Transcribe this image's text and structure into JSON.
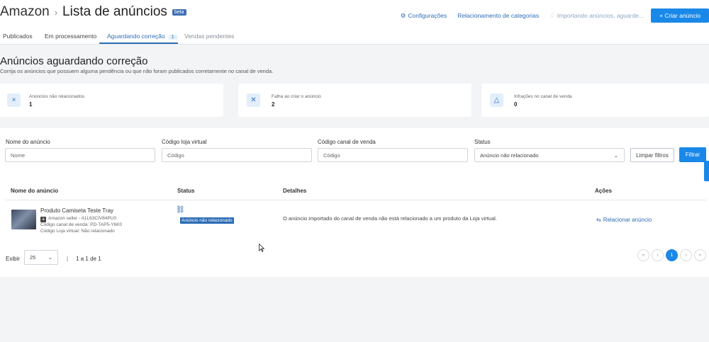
{
  "header": {
    "marketplace": "Amazon",
    "separator": "›",
    "title": "Lista de anúncios",
    "badge": "beta",
    "actions": [
      {
        "icon": "gear-icon",
        "label": "Configurações"
      },
      {
        "icon": "",
        "label": "Relacionamento de categorias"
      },
      {
        "icon": "lightbulb-icon",
        "label": "Importando anúncios, aguarde..."
      }
    ],
    "create_button": "+ Criar anúncio"
  },
  "tabs": [
    {
      "label": "Publicados",
      "count": null,
      "active": false
    },
    {
      "label": "Em processamento",
      "count": null,
      "active": false
    },
    {
      "label": "Aguardando correção",
      "count": "1",
      "active": true
    },
    {
      "label": "Vendas pendentes",
      "count": null,
      "active": false
    }
  ],
  "page": {
    "heading": "Anúncios aguardando correção",
    "subheading": "Corrija os anúncios que possuem alguma pendência ou que não foram publicados corretamente no canal de venda."
  },
  "cards": [
    {
      "icon": "x-icon",
      "label": "Anúncios não relacionados",
      "value": "1"
    },
    {
      "icon": "tools-icon",
      "label": "Falha ao criar o anúncio",
      "value": "2"
    },
    {
      "icon": "warning-icon",
      "label": "Infrações no canal de venda",
      "value": "0"
    }
  ],
  "filters": {
    "name": {
      "label": "Nome do anúncio",
      "placeholder": "Nome"
    },
    "store_code": {
      "label": "Código loja virtual",
      "placeholder": "Código"
    },
    "channel_code": {
      "label": "Código canal de venda",
      "placeholder": "Código"
    },
    "status": {
      "label": "Status",
      "value": "Anúncio não relacionado"
    },
    "clear_button": "Limpar filtros",
    "filter_button": "Filtrar"
  },
  "table": {
    "columns": [
      "Nome do anúncio",
      "Status",
      "Detalhes",
      "Ações"
    ],
    "rows": [
      {
        "name": "Produto Camiseta Teste Tray",
        "seller": "Amazon seller - A1L63CIV84PU0",
        "channel_code": "Código canal de venda: PD-TAP5-Y6K0",
        "store_code": "Código Loja virtual: Não relacionado",
        "status": "Anúncio não relacionado",
        "details": "O anúncio importado do canal de venda não está relacionado a um produto da Loja virtual.",
        "action": "Relacionar anúncio"
      }
    ]
  },
  "pagination": {
    "show_label": "Exibir",
    "per_page": "25",
    "separator": "|",
    "info": "1 a 1 de 1",
    "buttons": [
      "«",
      "‹",
      "1",
      "›",
      "»"
    ],
    "current": "1"
  }
}
